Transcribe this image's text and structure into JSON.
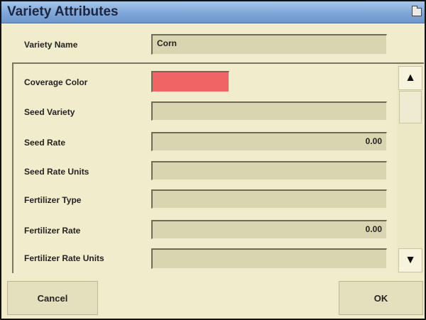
{
  "window": {
    "title": "Variety Attributes",
    "icon": "folder-icon"
  },
  "variety": {
    "label": "Variety Name",
    "value": "Corn"
  },
  "attributes": {
    "coverage_color": {
      "label": "Coverage Color",
      "color": "#f06466"
    },
    "seed_variety": {
      "label": "Seed Variety",
      "value": ""
    },
    "seed_rate": {
      "label": "Seed Rate",
      "value": "0.00"
    },
    "seed_rate_units": {
      "label": "Seed Rate Units",
      "value": ""
    },
    "fertilizer_type": {
      "label": "Fertilizer Type",
      "value": ""
    },
    "fertilizer_rate": {
      "label": "Fertilizer Rate",
      "value": "0.00"
    },
    "fertilizer_rate_units": {
      "label": "Fertilizer Rate Units",
      "value": ""
    }
  },
  "scrollbar": {
    "up_icon": "triangle-up-icon",
    "down_icon": "triangle-down-icon"
  },
  "buttons": {
    "cancel": "Cancel",
    "ok": "OK"
  }
}
